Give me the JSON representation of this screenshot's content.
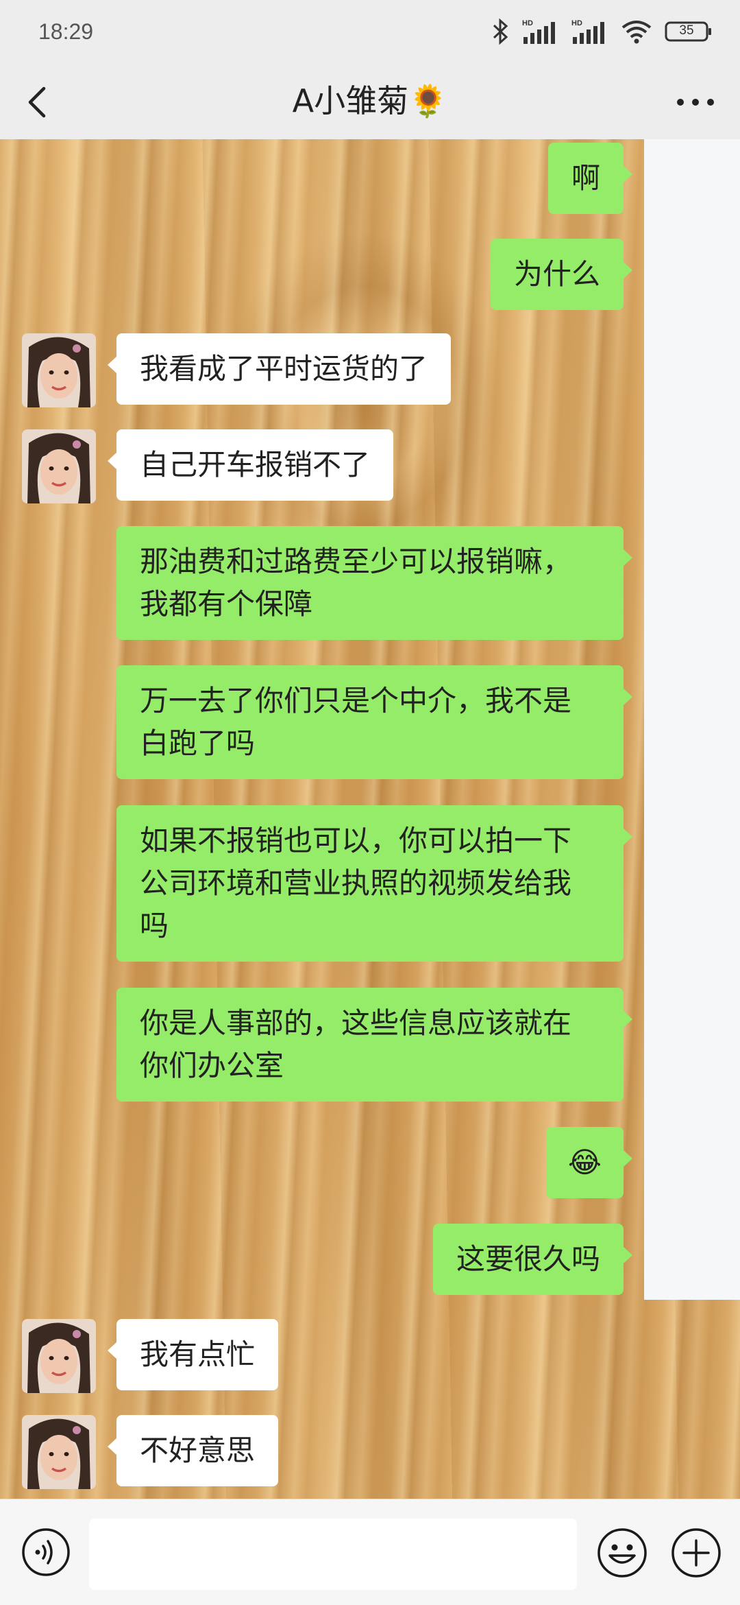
{
  "status_bar": {
    "time": "18:29",
    "battery": "35",
    "icons": [
      "bluetooth-icon",
      "hd-signal-icon",
      "hd-signal-icon",
      "wifi-icon",
      "battery-icon"
    ]
  },
  "header": {
    "title": "A小雏菊🌻",
    "back_icon": "chevron-left-icon",
    "more_icon": "more-dots-icon"
  },
  "messages": [
    {
      "side": "out",
      "text": "啊"
    },
    {
      "side": "out",
      "text": "为什么"
    },
    {
      "side": "in",
      "text": "我看成了平时运货的了"
    },
    {
      "side": "in",
      "text": "自己开车报销不了"
    },
    {
      "side": "out",
      "text": "那油费和过路费至少可以报销嘛，\n我都有个保障"
    },
    {
      "side": "out",
      "text": "万一去了你们只是个中介，我不是\n白跑了吗"
    },
    {
      "side": "out",
      "text": "如果不报销也可以，你可以拍一下\n公司环境和营业执照的视频发给我\n吗"
    },
    {
      "side": "out",
      "text": "你是人事部的，这些信息应该就在\n你们办公室"
    },
    {
      "side": "out",
      "text": "😂"
    },
    {
      "side": "out",
      "text": "这要很久吗"
    },
    {
      "side": "in",
      "text": "我有点忙"
    },
    {
      "side": "in",
      "text": "不好意思"
    }
  ],
  "input_bar": {
    "placeholder": "",
    "voice_icon": "voice-icon",
    "emoji_icon": "emoji-icon",
    "plus_icon": "plus-icon"
  },
  "colors": {
    "outgoing_bubble": "#95ec69",
    "incoming_bubble": "#ffffff",
    "bar_background": "#ededed"
  }
}
